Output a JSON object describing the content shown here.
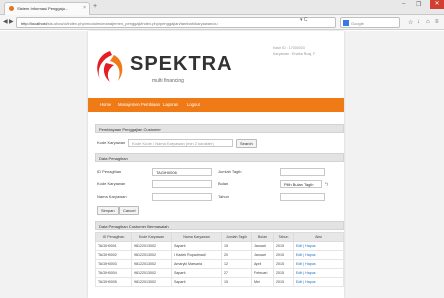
{
  "browser": {
    "tab_title": "Sistem Informasi Penggaju...",
    "tab_close": "×",
    "new_tab": "+",
    "url_host": "http://localhost",
    "url_path": "/sis-shcs/ci/index.php/modules/manajemen_penggaji/index.php/penggajian/tambah/karyawan/cu",
    "search_placeholder": "Google",
    "win_min": "–",
    "win_max": "❐",
    "win_close": "✕"
  },
  "header": {
    "brand": "SPEKTRA",
    "tagline": "multi financing",
    "user_id": "Kasir ID : 17000003",
    "user_name": "Karyawan : Erwika Ruaj, F"
  },
  "menu": {
    "items": [
      "Home",
      "Manajemen Pembiaan",
      "Laporan",
      "Logout"
    ]
  },
  "search_panel": {
    "title": "Pembiayaan Penggajian Customer",
    "label": "Kode Karyawan",
    "placeholder": "Kode Kode / Nama Karyawan (min 2 karakter)",
    "button": "Search"
  },
  "form_panel": {
    "title": "Data Penagihan",
    "id_label": "ID Penagihan",
    "id_value": "TAGIH0006",
    "kode_label": "Kode Karyawan",
    "nama_label": "Nama Karyawan",
    "jumlah_label": "Jumlah Tagih",
    "bulan_label": "Bulan",
    "bulan_select": "Pilih Bulan Tagih",
    "bulan_suffix": "*)",
    "tahun_label": "Tahun",
    "simpan": "Simpan",
    "cancel": "Cancel"
  },
  "table_panel": {
    "title": "Data Penagihan Customer Bermasalah",
    "headers": [
      "ID Penagihan",
      "Kode Karyawan",
      "Nama Karyawan",
      "Jumlah Tagih",
      "Bulan",
      "Tahun",
      "Aksi"
    ],
    "rows": [
      [
        "TAGIH0001",
        "98122013002",
        "Saparti",
        "15",
        "Januari",
        "2015",
        "Edit | Hapus"
      ],
      [
        "TAGIH0002",
        "98122013002",
        "I Kadek Rupadmadi",
        "20",
        "Januari",
        "2015",
        "Edit | Hapus"
      ],
      [
        "TAGIH0003",
        "98122013002",
        "Amaryki Marsaria",
        "12",
        "April",
        "2015",
        "Edit | Hapus"
      ],
      [
        "TAGIH0004",
        "98122013002",
        "Saparti",
        "27",
        "Februari",
        "2015",
        "Edit | Hapus"
      ],
      [
        "TAGIH0005",
        "98122013002",
        "Saparti",
        "15",
        "Mei",
        "2015",
        "Edit | Hapus"
      ]
    ]
  },
  "colors": {
    "accent": "#f07a16",
    "panel_header": "#e3e3e3",
    "link": "#1b6fc4"
  }
}
